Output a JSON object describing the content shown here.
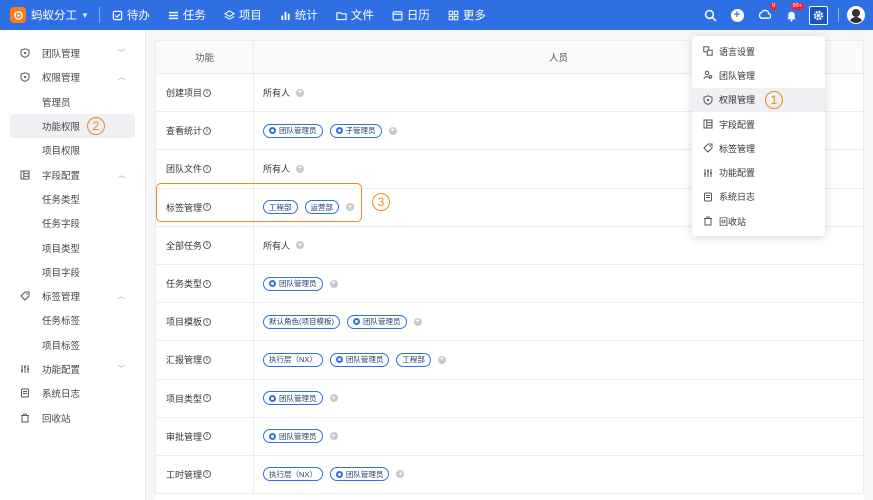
{
  "app": {
    "name": "蚂蚁分工"
  },
  "nav": [
    {
      "label": "待办",
      "icon": "check-square-icon"
    },
    {
      "label": "任务",
      "icon": "task-list-icon"
    },
    {
      "label": "项目",
      "icon": "layers-icon"
    },
    {
      "label": "统计",
      "icon": "bar-chart-icon"
    },
    {
      "label": "文件",
      "icon": "folder-icon"
    },
    {
      "label": "日历",
      "icon": "calendar-icon"
    },
    {
      "label": "更多",
      "icon": "grid-icon"
    }
  ],
  "header_right": {
    "badge_cloud": "9",
    "badge_bell": "99+"
  },
  "sidebar": {
    "groups": [
      {
        "label": "团队管理",
        "icon": "shield-icon",
        "chevron": "down",
        "children": []
      },
      {
        "label": "权限管理",
        "icon": "shield-icon",
        "chevron": "up",
        "children": [
          "管理员",
          "功能权限",
          "项目权限"
        ]
      },
      {
        "label": "字段配置",
        "icon": "fields-icon",
        "chevron": "up",
        "children": [
          "任务类型",
          "任务字段",
          "项目类型",
          "项目字段"
        ]
      },
      {
        "label": "标签管理",
        "icon": "tag-icon",
        "chevron": "up",
        "children": [
          "任务标签",
          "项目标签"
        ]
      },
      {
        "label": "功能配置",
        "icon": "sliders-icon",
        "chevron": "down",
        "children": []
      },
      {
        "label": "系统日志",
        "icon": "log-icon",
        "chevron": "",
        "children": []
      },
      {
        "label": "回收站",
        "icon": "trash-icon",
        "chevron": "",
        "children": []
      }
    ],
    "active": "功能权限"
  },
  "markers": {
    "one": "1",
    "two": "2",
    "three": "3"
  },
  "table": {
    "headers": {
      "func": "功能",
      "people": "人员"
    },
    "rows": [
      {
        "func": "创建项目",
        "people": [
          {
            "type": "plain",
            "text": "所有人"
          }
        ]
      },
      {
        "func": "查看统计",
        "people": [
          {
            "type": "role",
            "text": "团队管理员"
          },
          {
            "type": "role",
            "text": "子管理员"
          }
        ]
      },
      {
        "func": "团队文件",
        "people": [
          {
            "type": "plain",
            "text": "所有人"
          }
        ]
      },
      {
        "func": "标签管理",
        "people": [
          {
            "type": "tag",
            "text": "工程部"
          },
          {
            "type": "tag",
            "text": "运营部"
          }
        ]
      },
      {
        "func": "全部任务",
        "people": [
          {
            "type": "plain",
            "text": "所有人"
          }
        ]
      },
      {
        "func": "任务类型",
        "people": [
          {
            "type": "role",
            "text": "团队管理员"
          }
        ]
      },
      {
        "func": "项目模板",
        "people": [
          {
            "type": "tag",
            "text": "默认角色(项目模板)"
          },
          {
            "type": "role",
            "text": "团队管理员"
          }
        ]
      },
      {
        "func": "汇报管理",
        "people": [
          {
            "type": "tag",
            "text": "执行层（NX）"
          },
          {
            "type": "role",
            "text": "团队管理员"
          },
          {
            "type": "tag",
            "text": "工程部"
          }
        ]
      },
      {
        "func": "项目类型",
        "people": [
          {
            "type": "role",
            "text": "团队管理员"
          }
        ]
      },
      {
        "func": "审批管理",
        "people": [
          {
            "type": "role",
            "text": "团队管理员"
          }
        ]
      },
      {
        "func": "工时管理",
        "people": [
          {
            "type": "tag",
            "text": "执行层（NX）"
          },
          {
            "type": "role",
            "text": "团队管理员"
          }
        ]
      }
    ]
  },
  "dropdown": {
    "items": [
      {
        "label": "语言设置",
        "icon": "language-icon"
      },
      {
        "label": "团队管理",
        "icon": "team-icon"
      },
      {
        "label": "权限管理",
        "icon": "shield-icon"
      },
      {
        "label": "字段配置",
        "icon": "fields-icon"
      },
      {
        "label": "标签管理",
        "icon": "tag-icon"
      },
      {
        "label": "功能配置",
        "icon": "sliders-icon"
      },
      {
        "label": "系统日志",
        "icon": "log-icon"
      },
      {
        "label": "回收站",
        "icon": "trash-icon"
      }
    ],
    "active": "权限管理"
  }
}
